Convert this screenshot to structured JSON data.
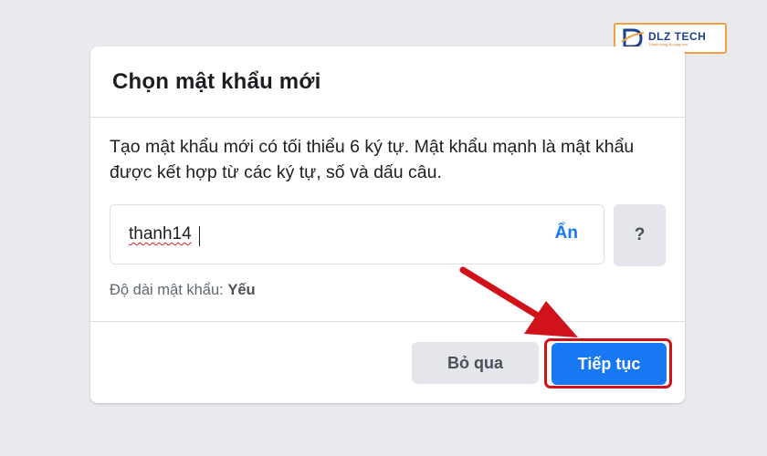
{
  "logo": {
    "brand": "DLZ TECH",
    "tagline": "Thành công đi cùng bạn",
    "color": "#1d3f8f"
  },
  "dialog": {
    "title": "Chọn mật khẩu mới",
    "description": "Tạo mật khẩu mới có tối thiểu 6 ký tự. Mật khẩu mạnh là mật khẩu được kết hợp từ các ký tự, số và dấu câu.",
    "password_value": "thanh14",
    "hide_label": "Ẩn",
    "help_label": "?",
    "strength_label": "Độ dài mật khẩu:",
    "strength_value": "Yếu",
    "skip_label": "Bỏ qua",
    "continue_label": "Tiếp tục"
  },
  "colors": {
    "primary": "#1877f2",
    "annotation": "#d0121b"
  }
}
